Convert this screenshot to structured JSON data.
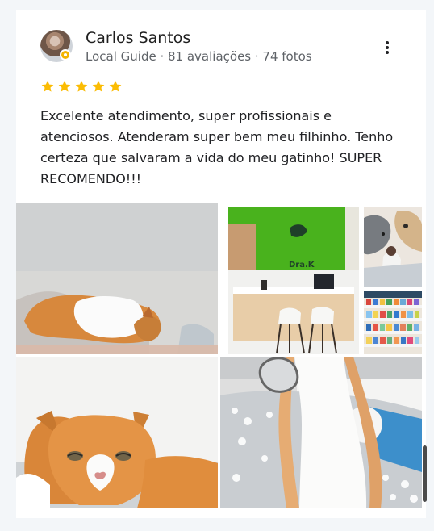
{
  "review": {
    "author_name": "Carlos Santos",
    "author_meta": "Local Guide · 81 avaliações · 74 fotos",
    "stars": 5,
    "text": "Excelente atendimento, super profissionais e atenciosos. Atenderam super bem meu filhinho. Tenho certeza que salvaram a vida do meu gatinho! SUPER RECOMENDO!!!"
  },
  "photos": {
    "clinic_sign": "Dra.K"
  },
  "icons": {
    "menu": "more-vert-icon",
    "badge": "local-guide-badge-icon",
    "star": "star-icon"
  },
  "colors": {
    "star": "#fbbc04",
    "meta_text": "#5f6368",
    "clinic_wall": "#4bb71f"
  }
}
